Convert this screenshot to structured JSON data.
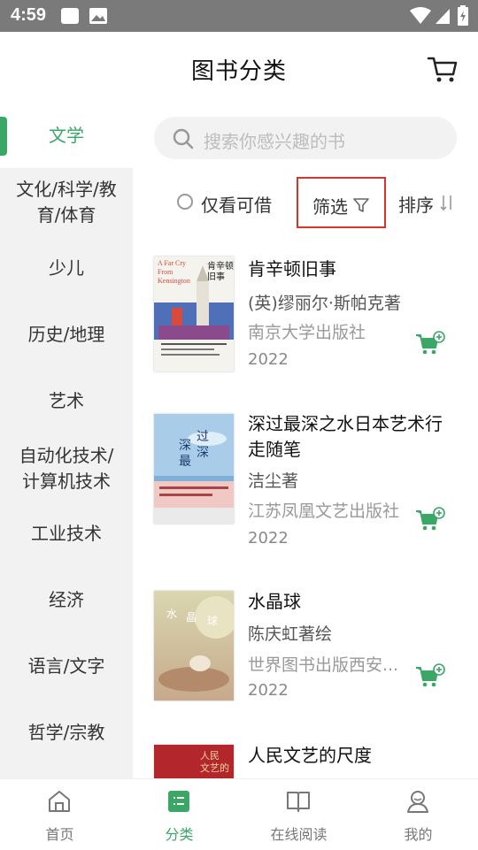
{
  "status_bar": {
    "time": "4:59"
  },
  "header": {
    "title": "图书分类",
    "cart_icon": "cart-icon"
  },
  "sidebar": {
    "items": [
      {
        "label": "文学",
        "active": true
      },
      {
        "label": "文化/科学/教育/体育"
      },
      {
        "label": "少儿"
      },
      {
        "label": "历史/地理"
      },
      {
        "label": "艺术"
      },
      {
        "label": "自动化技术/计算机技术"
      },
      {
        "label": "工业技术"
      },
      {
        "label": "经济"
      },
      {
        "label": "语言/文字"
      },
      {
        "label": "哲学/宗教"
      }
    ]
  },
  "search": {
    "placeholder": "搜索你感兴趣的书"
  },
  "filters": {
    "only_available": "仅看可借",
    "filter": "筛选",
    "sort": "排序"
  },
  "books": [
    {
      "title": "肯辛顿旧事",
      "author": "(英)缪丽尔·斯帕克著",
      "publisher": "南京大学出版社",
      "year": "2022",
      "cover_text": "A Far Cry From Kensington"
    },
    {
      "title": "深过最深之水日本艺术行走随笔",
      "author": "洁尘著",
      "publisher": "江苏凤凰文艺出版社",
      "year": "2022"
    },
    {
      "title": "水晶球",
      "author": "陈庆虹著绘",
      "publisher": "世界图书出版西安...",
      "year": "2022"
    },
    {
      "title": "人民文艺的尺度",
      "author": "",
      "publisher": "",
      "year": ""
    }
  ],
  "tabbar": {
    "tabs": [
      {
        "label": "首页"
      },
      {
        "label": "分类",
        "active": true
      },
      {
        "label": "在线阅读"
      },
      {
        "label": "我的"
      }
    ]
  },
  "colors": {
    "accent": "#3aa767",
    "filter_highlight": "#d9342b",
    "sidebar_bg": "#f2f2f2",
    "status_bar": "#7a7a7a"
  }
}
